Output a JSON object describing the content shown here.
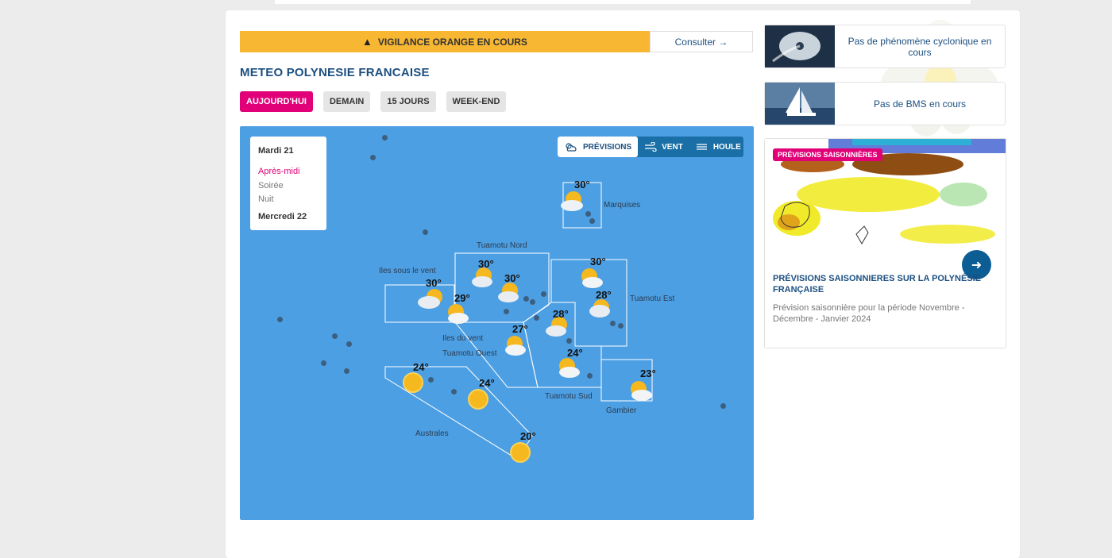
{
  "alert": {
    "text": "VIGILANCE ORANGE EN COURS",
    "button": "Consulter",
    "arrow": "→",
    "color": "#f7b733"
  },
  "page_title": "METEO POLYNESIE FRANCAISE",
  "tabs": [
    {
      "label": "AUJOURD'HUI",
      "active": true
    },
    {
      "label": "DEMAIN"
    },
    {
      "label": "15 JOURS"
    },
    {
      "label": "WEEK-END"
    }
  ],
  "day_selector": {
    "day1": "Mardi 21",
    "periods": [
      "Après-midi",
      "Soirée",
      "Nuit"
    ],
    "day2": "Mercredi 22"
  },
  "view_toggle": [
    "PRÉVISIONS",
    "VENT",
    "HOULE"
  ],
  "regions": [
    "Marquises",
    "Tuamotu Nord",
    "Iles sous le vent",
    "Tuamotu Est",
    "Iles du vent",
    "Tuamotu Ouest",
    "Tuamotu Sud",
    "Gambier",
    "Australes"
  ],
  "temps": {
    "t_marquises": "30°",
    "t_tuamotu_nord_1": "30°",
    "t_tuamotu_nord_2": "30°",
    "t_isv": "30°",
    "t_idv": "29°",
    "t_tuamotu_est_1": "30°",
    "t_tuamotu_est_2": "28°",
    "t_tuamotu_centre": "28°",
    "t_tuamotu_ouest": "27°",
    "t_tuamotu_sud": "24°",
    "t_gambier": "23°",
    "t_australes_1": "24°",
    "t_australes_2": "24°",
    "t_australes_3": "20°"
  },
  "side_cards": [
    {
      "text": "Pas de phénomène cyclonique en cours",
      "icon": "cyclone-satellite-image"
    },
    {
      "text": "Pas de BMS en cours",
      "icon": "sailboat-image"
    }
  ],
  "seasonal": {
    "badge": "PRÉVISIONS SAISONNIÈRES",
    "title": "PRÉVISIONS SAISONNIERES SUR LA POLYNÉSIE FRANÇAISE",
    "description": "Prévision saisonnière pour la période Novembre - Décembre - Janvier 2024",
    "arrow": "➜"
  },
  "colors": {
    "accent": "#e10078",
    "brand": "#1b4f80",
    "ocean": "#4d9fe3"
  }
}
